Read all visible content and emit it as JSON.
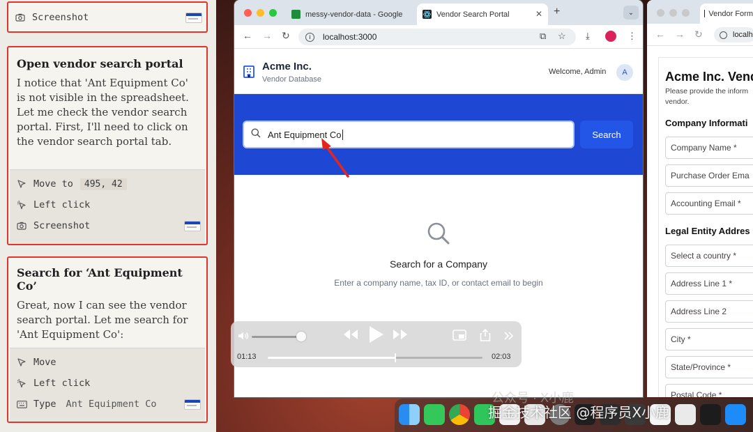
{
  "agent_log": {
    "card0": {
      "step_screenshot": "Screenshot"
    },
    "card1": {
      "title": "Open vendor search portal",
      "body": "I notice that 'Ant Equipment Co' is not visible in the spreadsheet. Let me check the vendor search portal. First, I'll need to click on the vendor search portal tab.",
      "step_move": "Move to",
      "step_move_coords": "495, 42",
      "step_click": "Left click",
      "step_screenshot": "Screenshot"
    },
    "card2": {
      "title": "Search for ‘Ant Equipment Co’",
      "body": "Great, now I can see the vendor search portal. Let me search for 'Ant Equipment Co':",
      "step_move": "Move",
      "step_click": "Left click",
      "step_type": "Type",
      "step_type_value": "Ant Equipment Co"
    }
  },
  "browser": {
    "tabs": [
      {
        "label": "messy-vendor-data - Google",
        "icon": "sheets-icon",
        "color": "#1e8e3e"
      },
      {
        "label": "Vendor Search Portal",
        "icon": "react-icon",
        "color": "#20232a"
      }
    ],
    "url": "localhost:3000",
    "page": {
      "brand_name": "Acme Inc.",
      "brand_sub": "Vendor Database",
      "welcome": "Welcome, Admin",
      "avatar_initial": "A",
      "search_value": "Ant Equipment Co",
      "search_button": "Search",
      "empty_title": "Search for a Company",
      "empty_sub": "Enter a company name, tax ID, or contact email to begin"
    },
    "colors": {
      "hero": "#1e48d4",
      "button": "#2356e6"
    }
  },
  "browser2": {
    "tab_label": "Vendor Form",
    "url": "localh",
    "form_title": "Acme Inc. Vendo",
    "form_sub": "Please provide the inform vendor.",
    "section_company": "Company Informati",
    "fields_company": [
      "Company Name *",
      "Purchase Order Ema",
      "Accounting Email *"
    ],
    "section_legal": "Legal Entity Addres",
    "fields_legal": [
      "Select a country *",
      "Address Line 1 *",
      "Address Line 2",
      "City *",
      "State/Province *",
      "Postal Code *"
    ]
  },
  "player": {
    "elapsed": "01:13",
    "total": "02:03",
    "progress": 0.593,
    "volume": 1.0
  },
  "watermark": {
    "main": "掘金技术社区 @程序员X小鹿",
    "ghost": "公众号 · X小鹿"
  }
}
